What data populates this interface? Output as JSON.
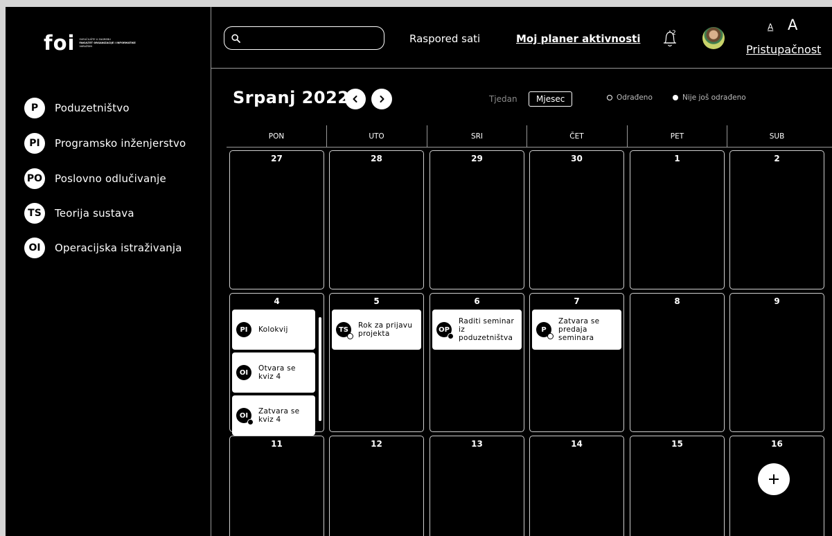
{
  "logo": {
    "mark": "foi",
    "line1": "SVEUČILIŠTE U ZAGREBU",
    "line2": "FAKULTET ORGANIZACIJE I INFORMATIKE",
    "line3": "VARAŽDIN"
  },
  "sidebar": {
    "courses": [
      {
        "code": "P",
        "name": "Poduzetništvo"
      },
      {
        "code": "PI",
        "name": "Programsko inženjerstvo"
      },
      {
        "code": "PO",
        "name": "Poslovno odlučivanje"
      },
      {
        "code": "TS",
        "name": "Teorija sustava"
      },
      {
        "code": "OI",
        "name": "Operacijska istraživanja"
      }
    ]
  },
  "header": {
    "search_value": "",
    "nav_schedule": "Raspored sati",
    "nav_planner": "Moj planer aktivnosti",
    "notification_count": "2",
    "font_small": "A",
    "font_large": "A",
    "accessibility": "Pristupačnost"
  },
  "calendar": {
    "title": "Srpanj 2022",
    "view_week": "Tjedan",
    "view_month": "Mjesec",
    "legend_done": "Odrađeno",
    "legend_not_done": "Nije još odrađeno",
    "weekdays": [
      "PON",
      "UTO",
      "SRI",
      "ČET",
      "PET",
      "SUB"
    ],
    "days": [
      "27",
      "28",
      "29",
      "30",
      "1",
      "2",
      "4",
      "5",
      "6",
      "7",
      "8",
      "9",
      "11",
      "12",
      "13",
      "14",
      "15",
      "16"
    ],
    "events": [
      {
        "badge": "PI",
        "text": "Kolokvij",
        "status": "none"
      },
      {
        "badge": "OI",
        "text": "Otvara se kviz 4",
        "status": "none"
      },
      {
        "badge": "OI",
        "text": "Zatvara se kviz 4",
        "status": "closed"
      },
      {
        "badge": "TS",
        "text": "Rok za prijavu projekta",
        "status": "open"
      },
      {
        "badge": "OP",
        "text": "Raditi seminar iz poduzetništva",
        "status": "closed"
      },
      {
        "badge": "P",
        "text": "Zatvara se predaja seminara",
        "status": "open"
      }
    ]
  },
  "icons": {
    "search": "search-icon",
    "prev": "chevron-left-icon",
    "next": "chevron-right-icon",
    "bell": "bell-icon",
    "add": "plus-icon"
  },
  "colors": {
    "background": "#000000",
    "foreground": "#ffffff",
    "divider": "#9a9a9a"
  }
}
